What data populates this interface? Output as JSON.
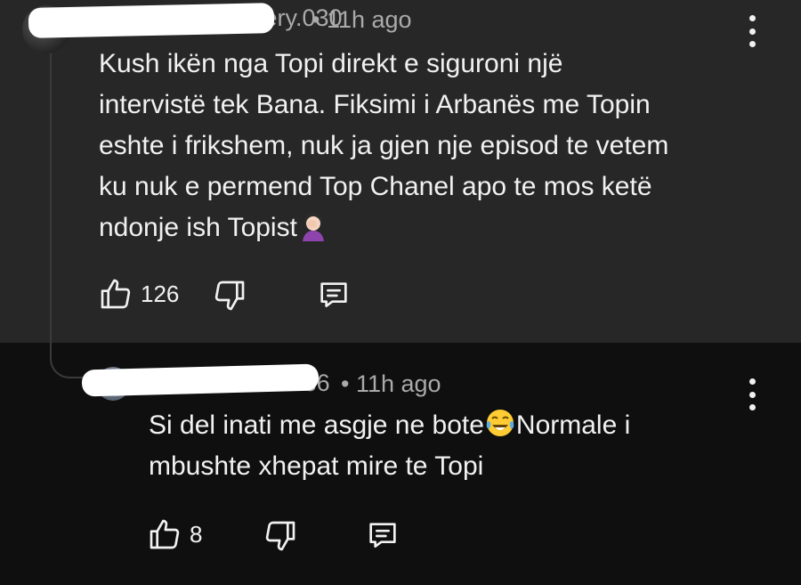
{
  "comments": [
    {
      "username_visible": "...ymery.030",
      "separator": "•",
      "time": "11h ago",
      "text_lines": [
        "Kush ikën nga Topi direkt e siguroni një",
        "intervistë tek Bana. Fiksimi i Arbanës me Topin",
        "eshte i frikshem, nuk ja gjen nje episod te vetem",
        "ku nuk e permend Top Chanel apo te mos ketë",
        "ndonje ish Topist"
      ],
      "emoji": "face-palm-emoji",
      "likes": "126",
      "avatar": "avatar-dark"
    },
    {
      "username_visible": "...a3338436",
      "separator": "•",
      "time": "11h ago",
      "text_lines": [
        "Si del inati me asgje ne bote",
        "Normale i",
        "mbushte xhepat mire te Topi"
      ],
      "emoji": "tears-of-joy-emoji",
      "likes": "8",
      "avatar": "avatar-light"
    }
  ],
  "icons": {
    "like": "thumbs-up-icon",
    "dislike": "thumbs-down-icon",
    "reply": "reply-comment-icon",
    "menu": "more-vertical-icon"
  },
  "colors": {
    "top_background": "#272727",
    "reply_background": "#0f0f0f",
    "text": "#f1f1f1",
    "meta": "#aaaaaa",
    "redaction": "#ffffff"
  }
}
